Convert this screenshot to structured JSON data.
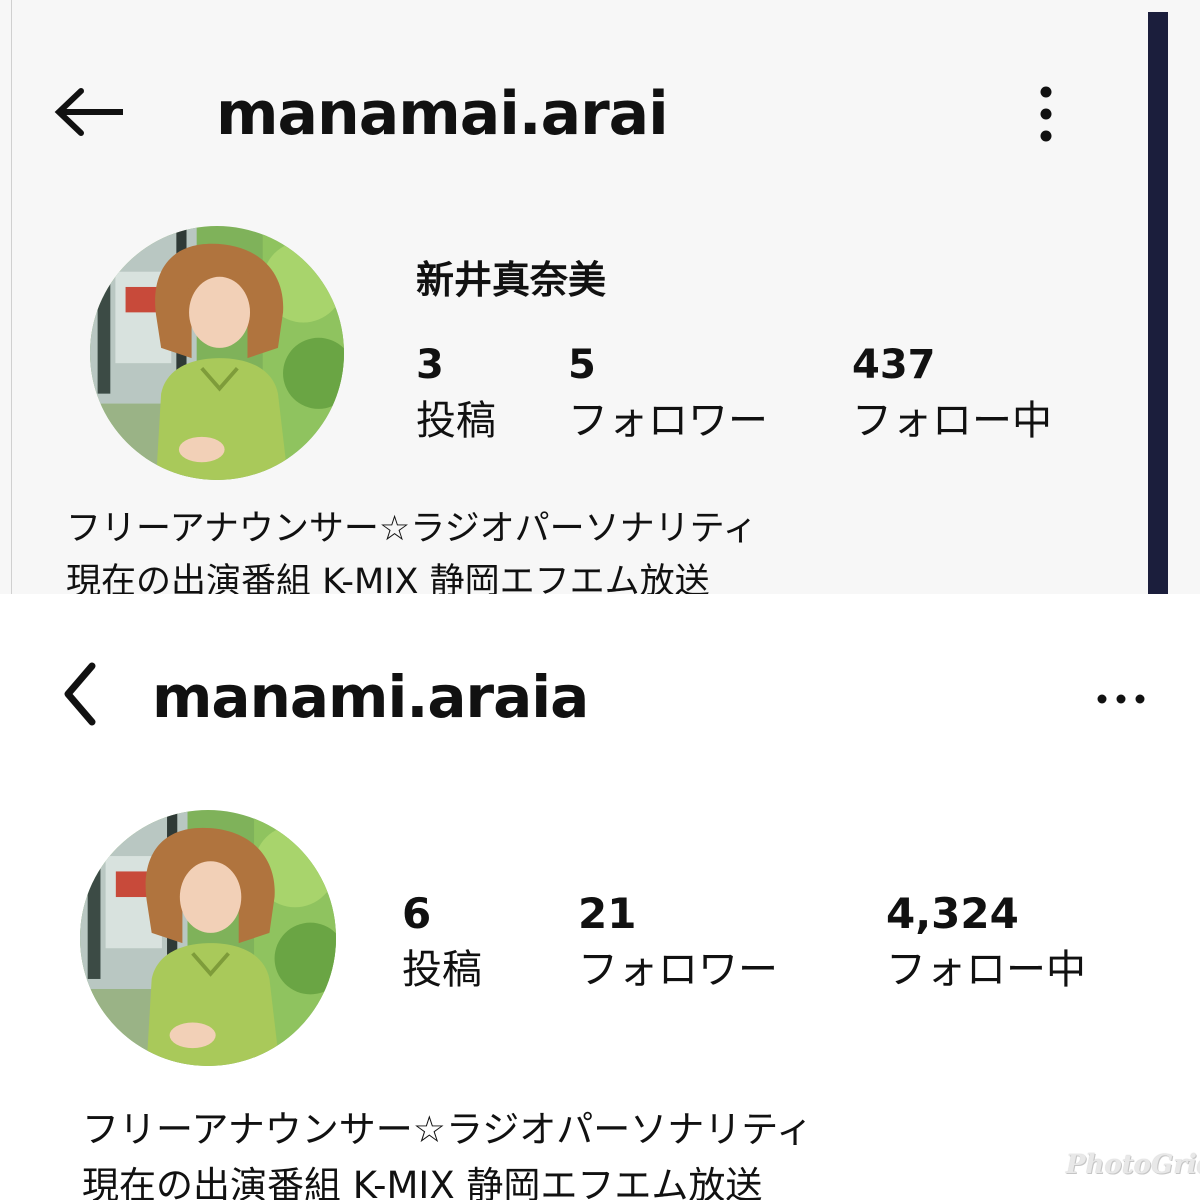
{
  "top": {
    "username": "manamai.arai",
    "display_name": "新井真奈美",
    "stats": [
      {
        "value": "3",
        "label": "投稿"
      },
      {
        "value": "5",
        "label": "フォロワー"
      },
      {
        "value": "437",
        "label": "フォロー中"
      }
    ],
    "bio": [
      "フリーアナウンサー☆ラジオパーソナリティ",
      "現在の出演番組 K-MIX 静岡エフエム放送"
    ],
    "icons": {
      "back": "arrow-left-icon",
      "menu": "more-vertical-icon"
    }
  },
  "bottom": {
    "username": "manami.araia",
    "stats": [
      {
        "value": "6",
        "label": "投稿"
      },
      {
        "value": "21",
        "label": "フォロワー"
      },
      {
        "value": "4,324",
        "label": "フォロー中"
      }
    ],
    "bio": [
      "フリーアナウンサー☆ラジオパーソナリティ",
      "現在の出演番組 K-MIX 静岡エフエム放送"
    ],
    "icons": {
      "back": "chevron-left-icon",
      "menu": "more-horizontal-icon"
    }
  },
  "watermark": "PhotoGrid",
  "colors": {
    "scrollbar": "#1b1e3c",
    "top_background": "#f7f7f7",
    "bottom_background": "#ffffff"
  }
}
